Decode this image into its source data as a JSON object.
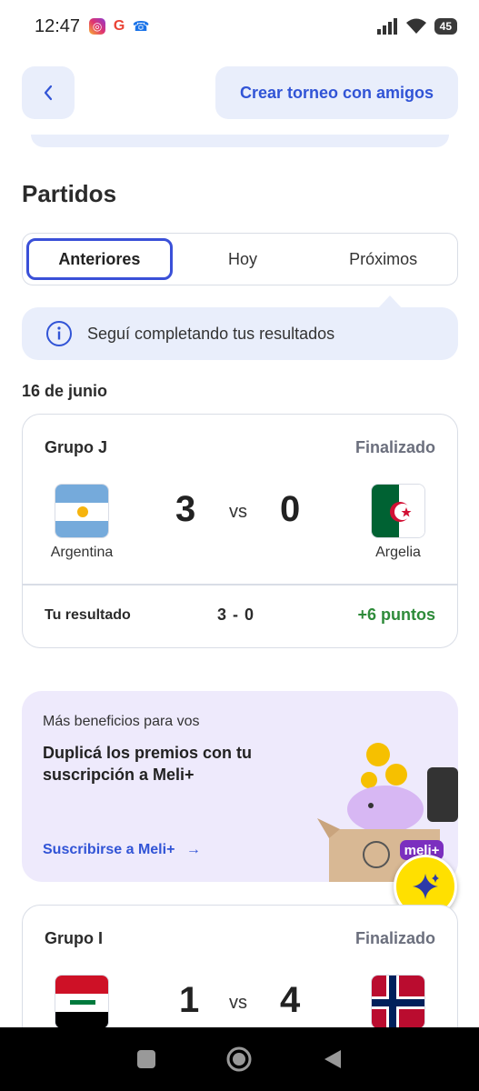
{
  "status_bar": {
    "time": "12:47",
    "battery": "45"
  },
  "header": {
    "create_button": "Crear torneo con amigos"
  },
  "section_title": "Partidos",
  "tabs": [
    {
      "label": "Anteriores",
      "active": true
    },
    {
      "label": "Hoy",
      "active": false
    },
    {
      "label": "Próximos",
      "active": false
    }
  ],
  "info_banner": {
    "text": "Seguí completando tus resultados"
  },
  "date": "16 de junio",
  "matches": [
    {
      "group": "Grupo J",
      "status": "Finalizado",
      "home": {
        "name": "Argentina",
        "score": "3"
      },
      "away": {
        "name": "Argelia",
        "score": "0"
      },
      "vs": "vs",
      "result_label": "Tu resultado",
      "result_score": "3 - 0",
      "points": "+6 puntos"
    },
    {
      "group": "Grupo I",
      "status": "Finalizado",
      "home": {
        "score": "1"
      },
      "away": {
        "score": "4"
      },
      "vs": "vs"
    }
  ],
  "promo": {
    "small": "Más beneficios para vos",
    "title": "Duplicá los premios con tu suscripción a Meli+",
    "link": "Suscribirse a Meli+",
    "badge": "meli+"
  },
  "colors": {
    "accent": "#3154d6",
    "points_green": "#2e8b3a",
    "promo_bg": "#eeeafc"
  }
}
